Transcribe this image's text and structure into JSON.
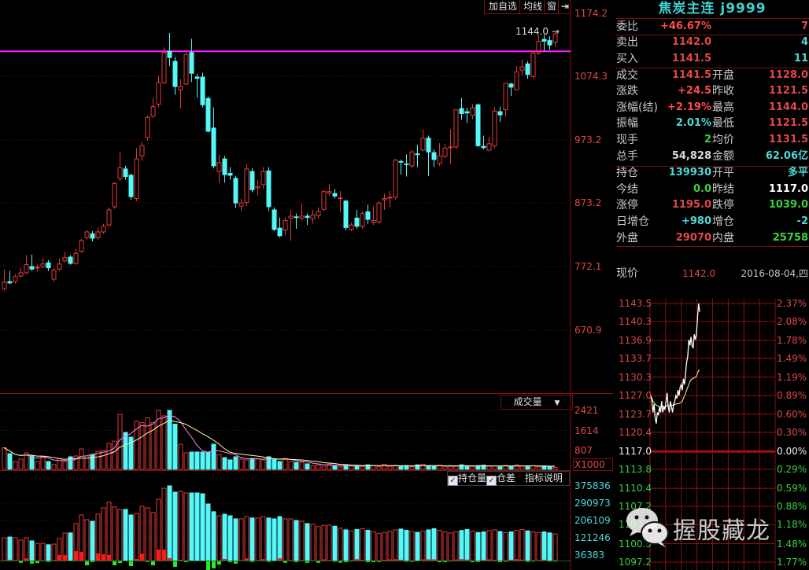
{
  "toolbar": {
    "add_watchlist": "加自选",
    "ma": "均线",
    "window": "窗",
    "collapse_icon": "arrow-right-bar-icon"
  },
  "colors": {
    "up": "#e03a3a",
    "down": "#54f8f8",
    "grid": "#6a1010",
    "hline": "#ff20ff",
    "ma5": "#ff80ff",
    "ma10": "#ffffa0",
    "oi_up": "#ff1a1a",
    "oi_down": "#22ee22",
    "intraday_price": "#ffffff",
    "intraday_avg": "#ffff90"
  },
  "main_chart": {
    "price_axis": [
      "1174.2",
      "1074.3",
      "973.2",
      "873.2",
      "772.1",
      "670.9"
    ],
    "high_marker": "1144.0",
    "horizontal_line": 1114
  },
  "volume_panel": {
    "title": "成交量",
    "axis": [
      "2421",
      "1614",
      "807"
    ],
    "unit": "X1000"
  },
  "oi_panel": {
    "legend_oi": "持仓量",
    "legend_diff": "仓差",
    "help": "指标说明",
    "axis": [
      "375836",
      "290973",
      "206109",
      "121246",
      "36383"
    ]
  },
  "chart_data": {
    "type": "candlestick",
    "ylim": [
      670.9,
      1174.2
    ],
    "ohlc": [
      [
        737,
        767,
        733,
        747
      ],
      [
        748,
        765,
        744,
        746
      ],
      [
        748,
        760,
        745,
        756
      ],
      [
        757,
        770,
        754,
        762
      ],
      [
        762,
        790,
        760,
        775
      ],
      [
        772,
        791,
        765,
        768
      ],
      [
        770,
        775,
        764,
        771
      ],
      [
        772,
        785,
        769,
        776
      ],
      [
        778,
        782,
        765,
        770
      ],
      [
        752,
        770,
        748,
        766
      ],
      [
        768,
        785,
        765,
        776
      ],
      [
        781,
        795,
        778,
        786
      ],
      [
        787,
        790,
        775,
        777
      ],
      [
        777,
        800,
        775,
        793
      ],
      [
        796,
        816,
        794,
        813
      ],
      [
        818,
        830,
        815,
        827
      ],
      [
        824,
        828,
        812,
        817
      ],
      [
        818,
        834,
        814,
        827
      ],
      [
        827,
        840,
        824,
        836
      ],
      [
        838,
        866,
        835,
        862
      ],
      [
        867,
        906,
        864,
        904
      ],
      [
        912,
        954,
        908,
        929
      ],
      [
        927,
        932,
        910,
        915
      ],
      [
        917,
        920,
        878,
        883
      ],
      [
        880,
        960,
        876,
        943
      ],
      [
        948,
        970,
        940,
        964
      ],
      [
        977,
        1012,
        972,
        1009
      ],
      [
        1011,
        1040,
        1008,
        1026
      ],
      [
        1030,
        1075,
        1025,
        1064
      ],
      [
        1064,
        1120,
        1062,
        1112
      ],
      [
        1114,
        1143,
        1090,
        1104
      ],
      [
        1098,
        1105,
        1045,
        1058
      ],
      [
        1053,
        1070,
        1023,
        1058
      ],
      [
        1062,
        1112,
        1060,
        1109
      ],
      [
        1112,
        1134,
        1065,
        1079
      ],
      [
        1073,
        1078,
        1040,
        1071
      ],
      [
        1073,
        1080,
        1025,
        1029
      ],
      [
        1039,
        1042,
        985,
        987
      ],
      [
        992,
        1025,
        928,
        932
      ],
      [
        923,
        950,
        905,
        937
      ],
      [
        943,
        948,
        905,
        918
      ],
      [
        920,
        930,
        910,
        917
      ],
      [
        912,
        916,
        865,
        873
      ],
      [
        868,
        880,
        860,
        873
      ],
      [
        874,
        935,
        868,
        927
      ],
      [
        923,
        928,
        890,
        894
      ],
      [
        897,
        910,
        885,
        899
      ],
      [
        902,
        930,
        895,
        923
      ],
      [
        924,
        930,
        860,
        867
      ],
      [
        862,
        866,
        828,
        831
      ],
      [
        833,
        850,
        818,
        821
      ],
      [
        830,
        850,
        822,
        845
      ],
      [
        849,
        862,
        813,
        852
      ],
      [
        851,
        856,
        832,
        850
      ],
      [
        849,
        872,
        845,
        852
      ],
      [
        852,
        856,
        838,
        850
      ],
      [
        848,
        862,
        840,
        854
      ],
      [
        853,
        866,
        848,
        859
      ],
      [
        863,
        893,
        860,
        891
      ],
      [
        889,
        903,
        885,
        891
      ],
      [
        888,
        895,
        880,
        884
      ],
      [
        880,
        892,
        858,
        881
      ],
      [
        876,
        878,
        830,
        834
      ],
      [
        831,
        842,
        828,
        838
      ],
      [
        849,
        862,
        832,
        836
      ],
      [
        836,
        860,
        832,
        856
      ],
      [
        859,
        870,
        840,
        847
      ],
      [
        842,
        868,
        838,
        845
      ],
      [
        843,
        876,
        840,
        873
      ],
      [
        878,
        888,
        862,
        880
      ],
      [
        881,
        892,
        866,
        882
      ],
      [
        882,
        943,
        878,
        941
      ],
      [
        939,
        942,
        918,
        938
      ],
      [
        935,
        950,
        915,
        934
      ],
      [
        932,
        957,
        928,
        954
      ],
      [
        951,
        965,
        930,
        950
      ],
      [
        957,
        990,
        955,
        976
      ],
      [
        976,
        980,
        916,
        954
      ],
      [
        953,
        958,
        930,
        942
      ],
      [
        936,
        968,
        932,
        948
      ],
      [
        947,
        967,
        944,
        960
      ],
      [
        962,
        990,
        935,
        962
      ],
      [
        962,
        1022,
        958,
        1021
      ],
      [
        1023,
        1040,
        1005,
        1015
      ],
      [
        1018,
        1024,
        1000,
        1016
      ],
      [
        1012,
        1030,
        1006,
        1024
      ],
      [
        1029,
        1031,
        962,
        964
      ],
      [
        963,
        980,
        958,
        961
      ],
      [
        957,
        978,
        955,
        967
      ],
      [
        964,
        1025,
        960,
        1019
      ],
      [
        1018,
        1026,
        1002,
        1013
      ],
      [
        1021,
        1064,
        1010,
        1063
      ],
      [
        1062,
        1064,
        1043,
        1057
      ],
      [
        1053,
        1090,
        1052,
        1081
      ],
      [
        1084,
        1101,
        1075,
        1089
      ],
      [
        1094,
        1098,
        1070,
        1077
      ],
      [
        1074,
        1115,
        1071,
        1111
      ],
      [
        1111,
        1140,
        1108,
        1130
      ],
      [
        1133,
        1140,
        1114,
        1130
      ],
      [
        1131,
        1138,
        1116,
        1124
      ],
      [
        1128,
        1144,
        1121.5,
        1141.5
      ]
    ],
    "volume_thousands": [
      917,
      680,
      365,
      460,
      712,
      585,
      365,
      555,
      365,
      240,
      490,
      365,
      555,
      585,
      870,
      585,
      648,
      775,
      807,
      1090,
      1185,
      2260,
      1535,
      1345,
      1995,
      1930,
      2120,
      1930,
      2421,
      2200,
      2421,
      1870,
      1060,
      712,
      745,
      745,
      745,
      745,
      1060,
      650,
      520,
      430,
      555,
      460,
      430,
      490,
      460,
      430,
      555,
      460,
      365,
      490,
      365,
      330,
      330,
      270,
      190,
      230,
      180,
      260,
      200,
      150,
      240,
      180,
      210,
      160,
      230,
      190,
      150,
      250,
      170,
      210,
      160,
      200,
      150,
      230,
      250,
      180,
      160,
      210,
      150,
      200,
      170,
      230,
      180,
      150,
      200,
      220,
      170,
      190,
      150,
      210,
      160,
      230,
      180,
      170,
      200,
      150,
      190,
      160,
      130
    ],
    "open_interest": [
      121000,
      125000,
      121000,
      110000,
      121000,
      106000,
      94000,
      94000,
      87000,
      90000,
      117000,
      144000,
      145000,
      191000,
      233000,
      210000,
      202000,
      237000,
      268000,
      295000,
      272000,
      260000,
      260000,
      233000,
      241000,
      275000,
      268000,
      245000,
      310000,
      364000,
      375836,
      345000,
      349000,
      341000,
      341000,
      341000,
      337000,
      287000,
      249000,
      229000,
      237000,
      229000,
      214000,
      214000,
      225000,
      218000,
      218000,
      225000,
      218000,
      214000,
      225000,
      214000,
      214000,
      206000,
      202000,
      191000,
      187000,
      176000,
      182000,
      184000,
      178000,
      168000,
      160000,
      155000,
      162000,
      166000,
      158000,
      150000,
      143000,
      147000,
      153000,
      160000,
      164000,
      158000,
      152000,
      148000,
      154000,
      160000,
      166000,
      158000,
      150000,
      145000,
      150000,
      157000,
      162000,
      154000,
      147000,
      150000,
      156000,
      160000,
      152000,
      146000,
      150000,
      157000,
      162000,
      155000,
      150000,
      146000,
      150000,
      145000,
      139930
    ]
  },
  "info": {
    "title": "焦炭主连 j9999",
    "rows": [
      {
        "l1": "委比",
        "v1": "+46.67%",
        "c1": "#ff4a4a",
        "l2": "",
        "v2": "7",
        "c2": "#e04848"
      },
      {
        "l1": "卖出",
        "v1": "1142.0",
        "c1": "#e04848",
        "l2": "",
        "v2": "4",
        "c2": "#4fd8d8"
      },
      {
        "l1": "买入",
        "v1": "1141.5",
        "c1": "#e04848",
        "l2": "",
        "v2": "11",
        "c2": "#4fd8d8"
      },
      {
        "l1": "成交",
        "v1": "1141.5",
        "c1": "#e04848",
        "l2": "开盘",
        "v2": "1128.0",
        "c2": "#e04848"
      },
      {
        "l1": "涨跌",
        "v1": "+24.5",
        "c1": "#ff4a4a",
        "l2": "昨收",
        "v2": "1121.5",
        "c2": "#e04848"
      },
      {
        "l1": "涨幅(结)",
        "v1": "+2.19%",
        "c1": "#ff4a4a",
        "l2": "最高",
        "v2": "1144.0",
        "c2": "#e04848"
      },
      {
        "l1": "振幅",
        "v1": "2.01%",
        "c1": "#4fd8d8",
        "l2": "最低",
        "v2": "1121.5",
        "c2": "#e04848"
      },
      {
        "l1": "现手",
        "v1": "2",
        "c1": "#3cd23c",
        "l2": "均价",
        "v2": "1131.5",
        "c2": "#e04848"
      },
      {
        "l1": "总手",
        "v1": "54,828",
        "c1": "#d8d8d8",
        "l2": "金额",
        "v2": "62.06亿",
        "c2": "#4fd8d8"
      },
      {
        "l1": "持仓",
        "v1": "139930",
        "c1": "#4fd8d8",
        "l2": "开平",
        "v2": "多平",
        "c2": "#4fd8d8"
      },
      {
        "l1": "今结",
        "v1": "0.0",
        "c1": "#3cd23c",
        "l2": "昨结",
        "v2": "1117.0",
        "c2": "#ffffff"
      },
      {
        "l1": "涨停",
        "v1": "1195.0",
        "c1": "#e04848",
        "l2": "跌停",
        "v2": "1039.0",
        "c2": "#3cd23c"
      },
      {
        "l1": "日增仓",
        "v1": "+980",
        "c1": "#4fd8d8",
        "l2": "增仓",
        "v2": "-2",
        "c2": "#4fd8d8"
      },
      {
        "l1": "外盘",
        "v1": "29070",
        "c1": "#e04848",
        "l2": "内盘",
        "v2": "25758",
        "c2": "#3cd23c"
      }
    ],
    "current_label": "现价",
    "current_price": "1142.0",
    "date": "2016-08-04,四"
  },
  "intraday": {
    "price_axis": [
      "1143.5",
      "1140.3",
      "1136.9",
      "1133.7",
      "1130.3",
      "1127.0",
      "1123.7",
      "1120.4",
      "1117.0",
      "1113.8",
      "1110.4",
      "1107.2",
      "1103.9",
      "1100.5",
      "1097.2"
    ],
    "pct_axis": [
      "2.37%",
      "2.08%",
      "1.78%",
      "1.49%",
      "1.19%",
      "0.89%",
      "0.60%",
      "0.30%",
      "0.00%",
      "0.29%",
      "0.59%",
      "0.88%",
      "1.18%",
      "1.48%",
      "1.77%"
    ],
    "ylim": [
      1097.2,
      1143.5
    ],
    "price": [
      1127,
      1126,
      1124,
      1125.5,
      1123,
      1122,
      1124,
      1123.5,
      1125,
      1124,
      1126,
      1124,
      1125,
      1124.5,
      1126,
      1127.5,
      1125,
      1124,
      1126,
      1125,
      1124,
      1125.5,
      1126,
      1127,
      1126.5,
      1128,
      1127,
      1128.5,
      1129,
      1128,
      1130,
      1129,
      1131,
      1133,
      1134,
      1137,
      1136,
      1137.5,
      1136,
      1135.5,
      1138,
      1137,
      1138,
      1141,
      1143.5,
      1142
    ],
    "avg": [
      1127,
      1126.5,
      1126,
      1125.8,
      1125.5,
      1125.3,
      1125.2,
      1125.1,
      1125,
      1125,
      1125,
      1125,
      1125,
      1125,
      1125.1,
      1125.2,
      1125.2,
      1125.2,
      1125.3,
      1125.3,
      1125.3,
      1125.3,
      1125.4,
      1125.5,
      1125.5,
      1125.6,
      1125.6,
      1125.7,
      1125.8,
      1126,
      1126.5,
      1127,
      1127.5,
      1128,
      1128.5,
      1129,
      1129.5,
      1129.8,
      1130,
      1130.1,
      1130.2,
      1130.3,
      1130.5,
      1131,
      1131.5,
      1131.5
    ]
  },
  "watermark": {
    "text": "握股藏龙",
    "logo": "wechat-logo"
  }
}
